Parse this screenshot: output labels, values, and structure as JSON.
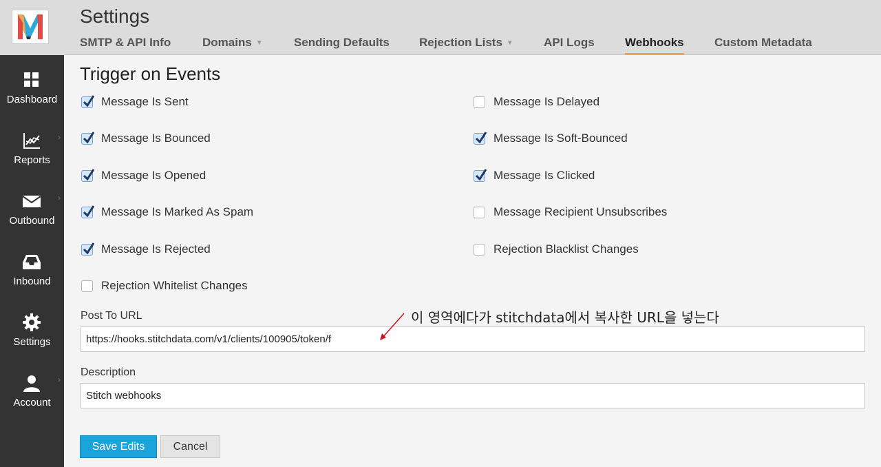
{
  "sidebar": {
    "items": [
      {
        "label": "Dashboard",
        "icon": "grid-icon"
      },
      {
        "label": "Reports",
        "icon": "chart-icon"
      },
      {
        "label": "Outbound",
        "icon": "envelope-icon"
      },
      {
        "label": "Inbound",
        "icon": "inbox-icon"
      },
      {
        "label": "Settings",
        "icon": "gear-icon"
      },
      {
        "label": "Account",
        "icon": "user-icon"
      }
    ]
  },
  "header": {
    "title": "Settings",
    "tabs": [
      {
        "label": "SMTP & API Info"
      },
      {
        "label": "Domains"
      },
      {
        "label": "Sending Defaults"
      },
      {
        "label": "Rejection Lists"
      },
      {
        "label": "API Logs"
      },
      {
        "label": "Webhooks"
      },
      {
        "label": "Custom Metadata"
      }
    ],
    "active_tab": "Webhooks"
  },
  "form": {
    "section_title": "Trigger on Events",
    "events": [
      {
        "label": "Message Is Sent",
        "checked": true
      },
      {
        "label": "Message Is Delayed",
        "checked": false
      },
      {
        "label": "Message Is Bounced",
        "checked": true
      },
      {
        "label": "Message Is Soft-Bounced",
        "checked": true
      },
      {
        "label": "Message Is Opened",
        "checked": true
      },
      {
        "label": "Message Is Clicked",
        "checked": true
      },
      {
        "label": "Message Is Marked As Spam",
        "checked": true
      },
      {
        "label": "Message Recipient Unsubscribes",
        "checked": false
      },
      {
        "label": "Message Is Rejected",
        "checked": true
      },
      {
        "label": "Rejection Blacklist Changes",
        "checked": false
      },
      {
        "label": "Rejection Whitelist Changes",
        "checked": false
      }
    ],
    "post_url_label": "Post To URL",
    "post_url_value": "https://hooks.stitchdata.com/v1/clients/100905/token/f",
    "description_label": "Description",
    "description_value": "Stitch webhooks",
    "save_label": "Save Edits",
    "cancel_label": "Cancel"
  },
  "annotation": {
    "text": "이 영역에다가 stitchdata에서 복사한 URL을 넣는다",
    "color": "#d0121b"
  },
  "colors": {
    "sidebar_bg": "#333333",
    "header_bg": "#dcdcdc",
    "active_tab_underline": "#e9a74f",
    "primary_button": "#1ba3db"
  }
}
